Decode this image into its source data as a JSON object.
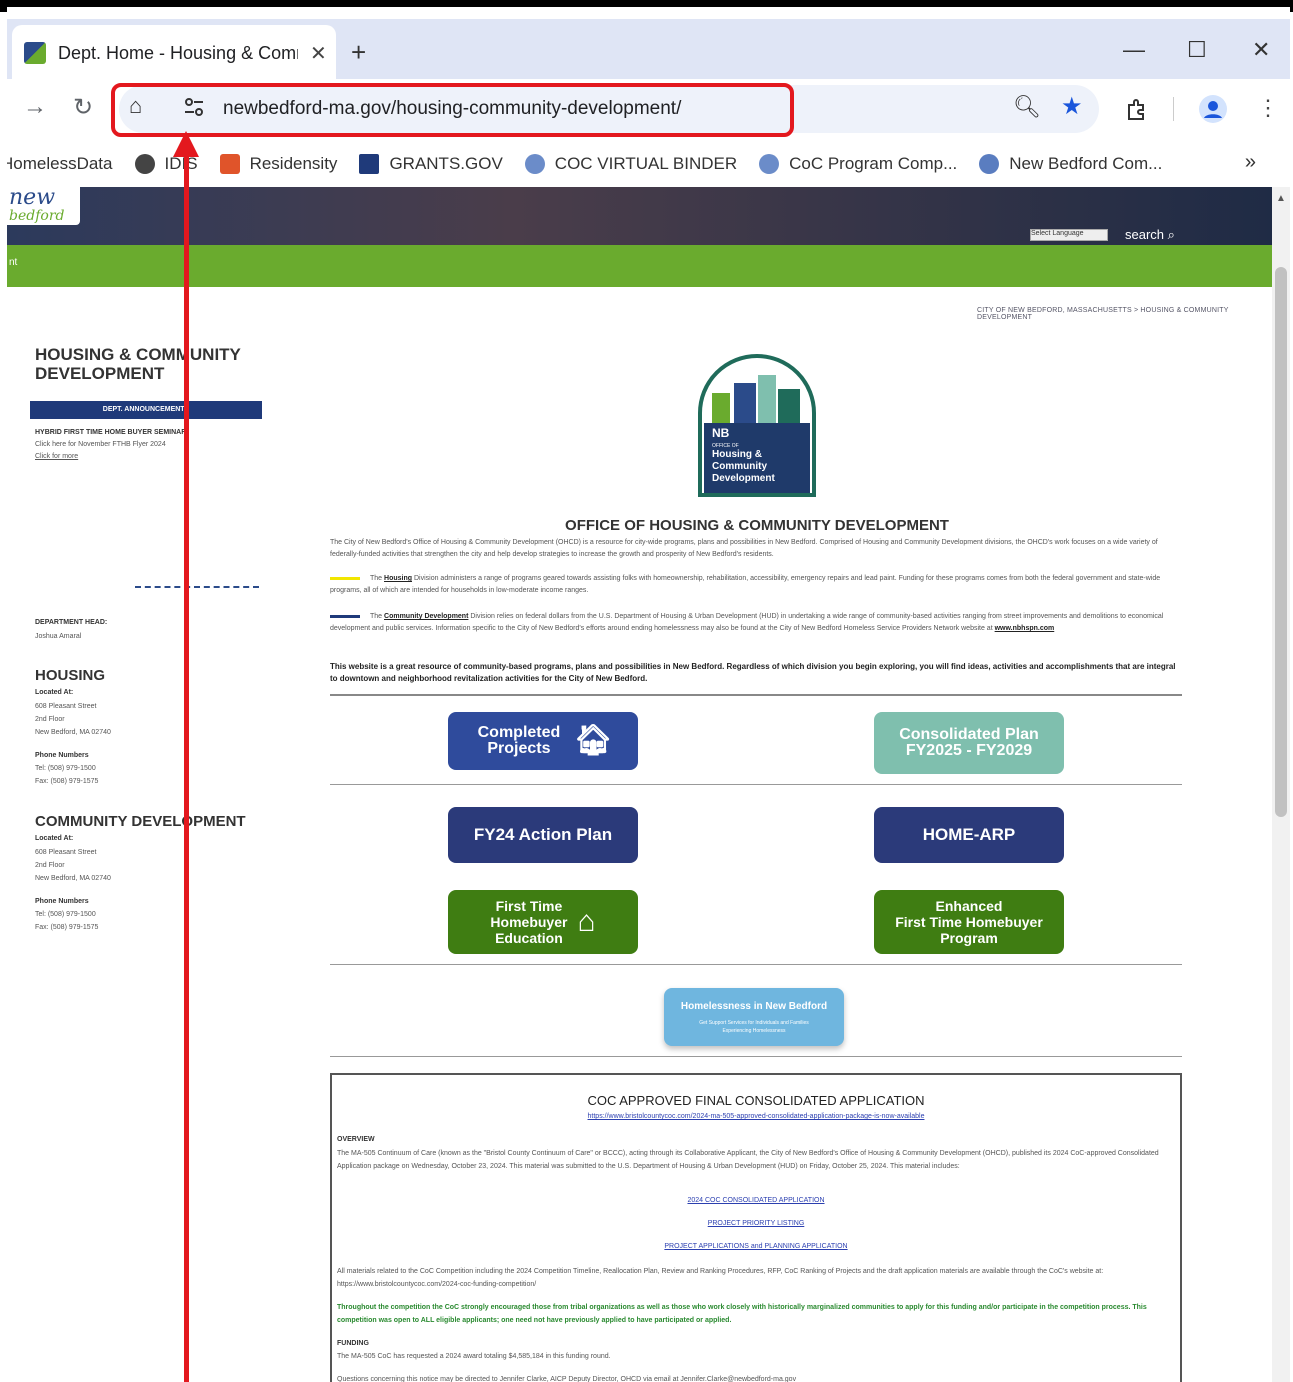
{
  "browser": {
    "tab_title": "Dept. Home - Housing & Comm",
    "new_tab": "+",
    "url": "newbedford-ma.gov/housing-community-development/",
    "controls": {
      "minimize": "—",
      "maximize": "☐",
      "close": "✕"
    }
  },
  "bookmarks": [
    {
      "label": "HomelessData",
      "color": "#ffffff"
    },
    {
      "label": "IDIS",
      "color": "#444444"
    },
    {
      "label": "Residensity",
      "color": "#e0542a"
    },
    {
      "label": "GRANTS.GOV",
      "color": "#1f3a7a"
    },
    {
      "label": "COC VIRTUAL BINDER",
      "color": "#6b8cc9"
    },
    {
      "label": "CoC Program Comp...",
      "color": "#6b8cc9"
    },
    {
      "label": "New Bedford Com...",
      "color": "#5a7dc0"
    }
  ],
  "bookmarks_more": "»",
  "site": {
    "logo_line1": "new",
    "logo_line2": "bedford",
    "nav_label": "nt",
    "search": "search",
    "lang": "Select Language",
    "breadcrumb": "CITY OF NEW BEDFORD, MASSACHUSETTS > HOUSING & COMMUNITY DEVELOPMENT"
  },
  "sidebar": {
    "title": "HOUSING & COMMUNITY DEVELOPMENT",
    "announce": "DEPT. ANNOUNCEMENTS",
    "announce_item": "HYBRID FIRST TIME HOME BUYER SEMINAR",
    "announce_sub": "Click here for November FTHB Flyer 2024",
    "announce_link": "Click for more",
    "head_label": "DEPARTMENT HEAD:",
    "head_name": "Joshua Amaral",
    "housing": {
      "title": "HOUSING",
      "located": "Located At:",
      "addr1": "608 Pleasant Street",
      "addr2": "2nd Floor",
      "addr3": "New Bedford, MA 02740",
      "phone_label": "Phone Numbers",
      "tel": "Tel: (508) 979-1500",
      "fax": "Fax: (508) 979-1575"
    },
    "cd": {
      "title": "COMMUNITY DEVELOPMENT",
      "located": "Located At:",
      "addr1": "608 Pleasant Street",
      "addr2": "2nd Floor",
      "addr3": "New Bedford, MA 02740",
      "phone_label": "Phone Numbers",
      "tel": "Tel: (508) 979-1500",
      "fax": "Fax: (508) 979-1575"
    }
  },
  "emblem": {
    "nb": "NB",
    "office_of": "OFFICE OF",
    "line1": "Housing &",
    "line2": "Community",
    "line3": "Development"
  },
  "main": {
    "title": "OFFICE OF HOUSING & COMMUNITY DEVELOPMENT",
    "intro": "The City of New Bedford's Office of Housing & Community Development (OHCD) is a resource for city-wide programs, plans and possibilities in New Bedford. Comprised of Housing and Community Development divisions, the OHCD's work focuses on a wide variety of federally-funded activities that strengthen the city and help develop strategies to increase the growth and prosperity of New Bedford's residents.",
    "housing_word": "Housing",
    "housing_text": "Division administers a range of programs geared towards assisting folks with homeownership, rehabilitation, accessibility, emergency repairs and lead paint. Funding for these programs comes from both the federal government and state-wide programs, all of which are intended for households in low-moderate income ranges.",
    "cd_word": "Community Development",
    "cd_text": "Division relies on federal dollars from the U.S. Department of Housing & Urban Development (HUD) in undertaking a wide range of community-based activities ranging from street improvements and demolitions to economical development and public services. Information specific to the City of New Bedford's efforts around ending homelessness may also be found at the City of New Bedford Homeless Service Providers Network website at",
    "cd_link": "www.nbhspn.com",
    "the": "The",
    "bold_text": "This website is a great resource of community-based programs, plans and possibilities in New Bedford. Regardless of which division you begin exploring, you will find ideas, activities and accomplishments that are integral to downtown and neighborhood revitalization activities for the City of New Bedford."
  },
  "buttons": {
    "completed": "Completed Projects",
    "consolidated_1": "Consolidated Plan",
    "consolidated_2": "FY2025 - FY2029",
    "fy24": "FY24 Action Plan",
    "homearp": "HOME-ARP",
    "fthe_1": "First Time",
    "fthe_2": "Homebuyer",
    "fthe_3": "Education",
    "efthb_1": "Enhanced",
    "efthb_2": "First Time Homebuyer",
    "efthb_3": "Program",
    "homeless": "Homelessness in New Bedford",
    "homeless_sub": "Get Support Services for Individuals and Families Experiencing Homelessness",
    "colors": {
      "blue": "#2f4b9c",
      "teal": "#7fbfae",
      "navy": "#2b3a7a",
      "green": "#3f7d12",
      "lightblue": "#6fb6df"
    }
  },
  "coc": {
    "title": "COC APPROVED FINAL CONSOLIDATED APPLICATION",
    "url": "https://www.bristolcountycoc.com/2024-ma-505-approved-consolidated-application-package-is-now-available",
    "overview_label": "OVERVIEW",
    "overview": "The MA-505 Continuum of Care (known as the \"Bristol County Continuum of Care\" or BCCC), acting through its Collaborative Applicant, the City of New Bedford's Office of Housing & Community Development (OHCD), published its 2024 CoC-approved Consolidated Application package on Wednesday, October 23, 2024. This material was submitted to the U.S. Department of Housing & Urban Development (HUD) on Friday, October 25, 2024. This material includes:",
    "link1": "2024 COC CONSOLIDATED APPLICATION",
    "link2": "PROJECT PRIORITY LISTING",
    "link3": "PROJECT APPLICATIONS and PLANNING APPLICATION",
    "materials": "All materials related to the CoC Competition including the 2024 Competition Timeline, Reallocation Plan, Review and Ranking Procedures, RFP, CoC Ranking of Projects and the draft application materials are available through the CoC's website at: https://www.bristolcountycoc.com/2024-coc-funding-competition/",
    "green": "Throughout the competition the CoC strongly encouraged those from tribal organizations as well as those who work closely with historically marginalized communities to apply for this funding and/or participate in the competition process. This competition was open to ALL eligible applicants; one need not have previously applied to have participated or applied.",
    "funding_label": "FUNDING",
    "funding": "The MA-505 CoC has requested a 2024 award totaling $4,585,184 in this funding round.",
    "questions": "Questions concerning this notice may be directed to Jennifer Clarke, AICP Deputy Director, OHCD via email at Jennifer.Clarke@newbedford-ma.gov"
  }
}
